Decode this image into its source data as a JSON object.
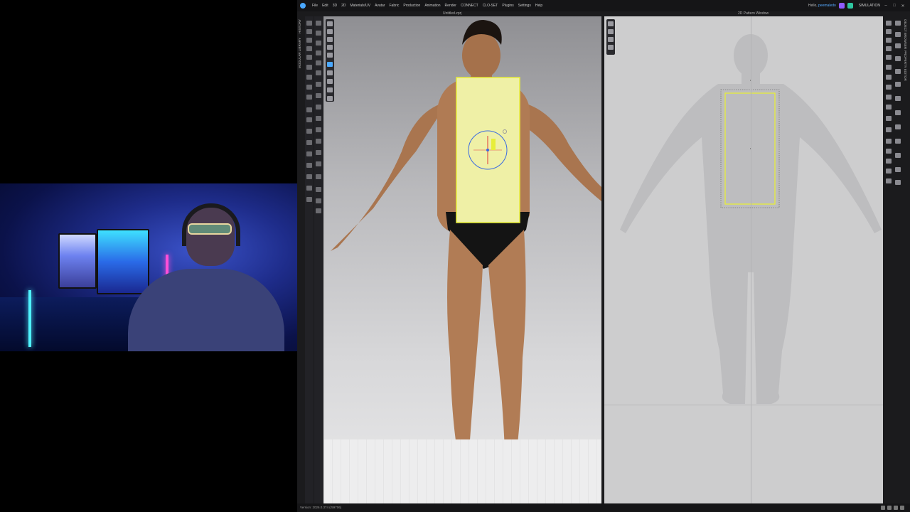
{
  "app": {
    "menu": [
      "File",
      "Edit",
      "3D",
      "2D",
      "Materials/UV",
      "Avatar",
      "Fabric",
      "Production",
      "Animation",
      "Render",
      "CONNECT",
      "CLO-SET",
      "Plugins",
      "Settings",
      "Help"
    ],
    "user_greeting": "Hello,",
    "user_name": "peemaledo",
    "mode": "SIMULATION",
    "window_controls": [
      "–",
      "□",
      "✕"
    ],
    "file_title": "Untitled.zprj",
    "pattern_window_title": "2D Pattern Window",
    "left_tabs": [
      "HISTORY",
      "MODULAR LIBRARY"
    ],
    "right_tabs": [
      "OBJECT BROWSER",
      "PROPERTY EDITOR"
    ],
    "version": "Version: 2026.0.374 (r59706)"
  },
  "colors": {
    "pattern_fill": "#eff0a6",
    "pattern_outline": "#e7ee3a",
    "accent": "#4aa8ff",
    "gizmo_red": "#e23a3a",
    "gizmo_blue": "#3a6be2"
  }
}
